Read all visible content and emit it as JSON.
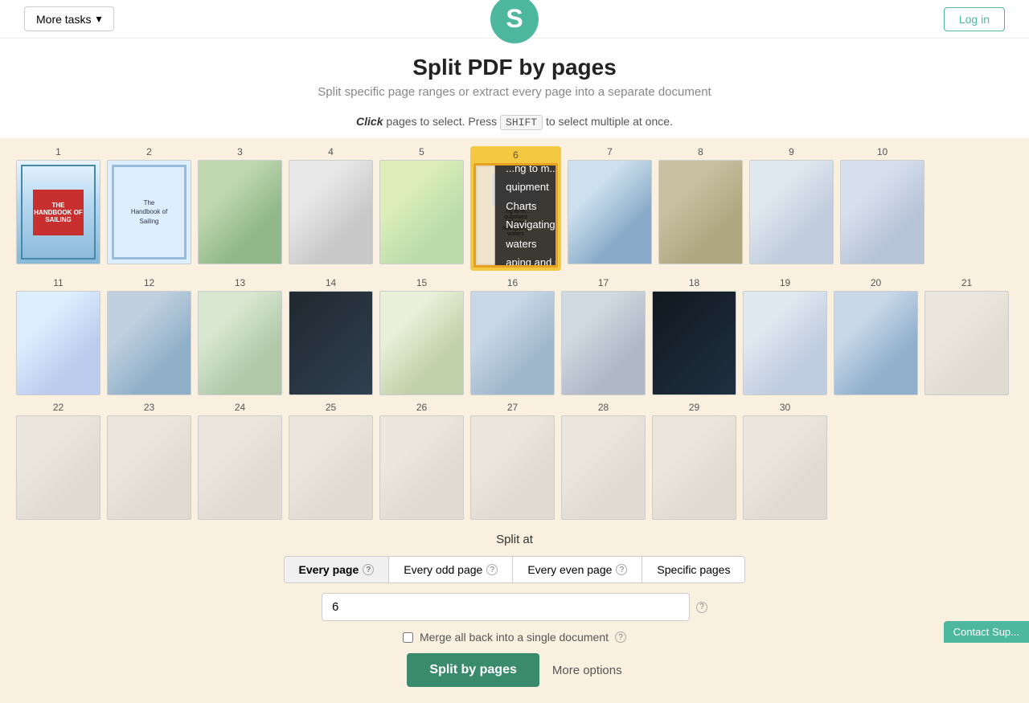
{
  "header": {
    "logo_letter": "S",
    "more_tasks_label": "More tasks",
    "chevron": "▾",
    "login_label": "Log in"
  },
  "title": {
    "heading": "Split PDF by pages",
    "subheading": "Split specific page ranges or extract every page into a separate document"
  },
  "instruction": {
    "click_word": "Click",
    "text1": "pages to select. Press",
    "shift_label": "SHIFT",
    "text2": "to select multiple at once."
  },
  "pages": {
    "rows": [
      {
        "nums": [
          1,
          2,
          3,
          4,
          5,
          6,
          7,
          8,
          9,
          10
        ]
      },
      {
        "nums": [
          11,
          12,
          13,
          14,
          15,
          16,
          17,
          18,
          19,
          20
        ]
      },
      {
        "nums": [
          21,
          22,
          23,
          24,
          25,
          26,
          27,
          28,
          29,
          30
        ]
      }
    ],
    "selected_page": 6,
    "tooltip": {
      "items": [
        "...ng to m...",
        "quipment",
        "Charts",
        "Navigating in tid...",
        "waters",
        "aping and pl..."
      ]
    }
  },
  "bottom_controls": {
    "split_at_label": "Split at",
    "options": [
      {
        "label": "Every page",
        "active": true,
        "has_info": true
      },
      {
        "label": "Every odd page",
        "active": false,
        "has_info": true
      },
      {
        "label": "Every even page",
        "active": false,
        "has_info": true
      },
      {
        "label": "Specific pages",
        "active": false,
        "has_info": false
      }
    ],
    "input_value": "6",
    "input_placeholder": "",
    "merge_label": "Merge all back into a single document",
    "split_btn_label": "Split by pages",
    "more_options_label": "More options"
  },
  "contact": {
    "label": "Contact Sup..."
  }
}
